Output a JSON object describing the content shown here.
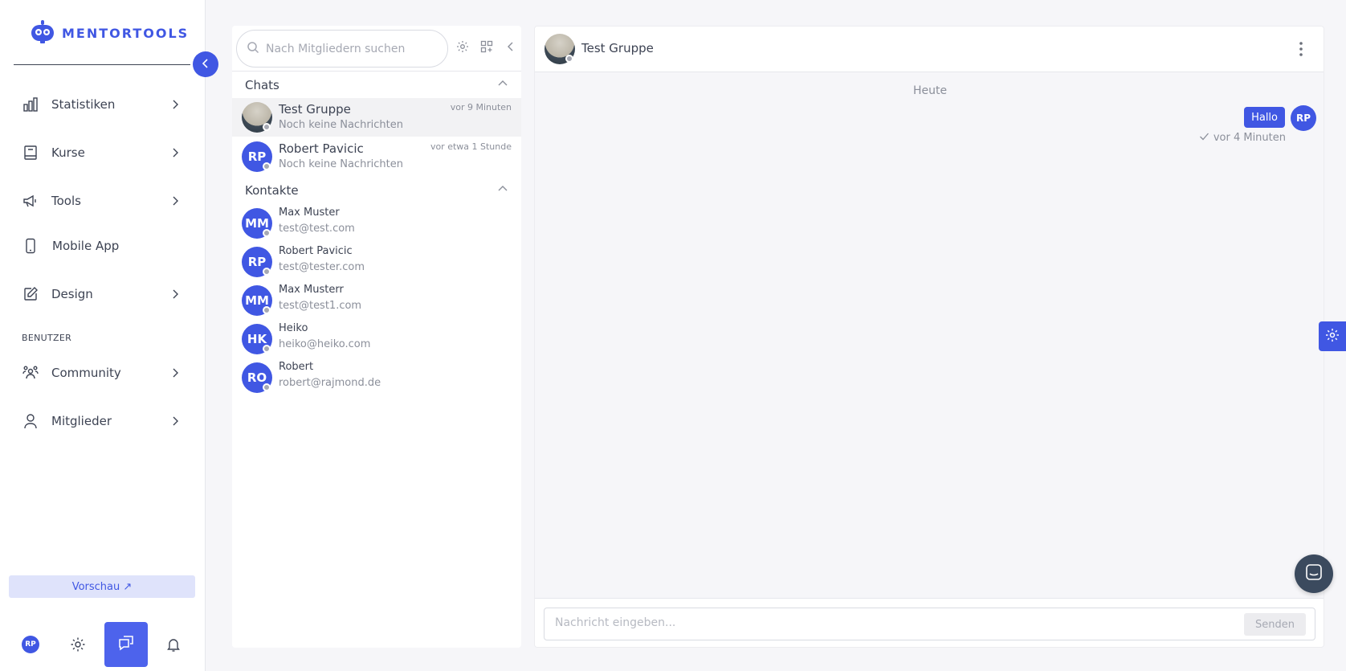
{
  "brand": {
    "name": "MENTORTOOLS",
    "accent": "#4057e3"
  },
  "sidebar": {
    "items": [
      {
        "label": "Statistiken",
        "icon": "bar-chart-icon",
        "has_chevron": true
      },
      {
        "label": "Kurse",
        "icon": "book-icon",
        "has_chevron": true
      },
      {
        "label": "Tools",
        "icon": "megaphone-icon",
        "has_chevron": true
      },
      {
        "label": "Mobile App",
        "icon": "smartphone-icon",
        "has_chevron": false
      },
      {
        "label": "Design",
        "icon": "pencil-icon",
        "has_chevron": true
      },
      {
        "label": "Community",
        "icon": "users-icon",
        "has_chevron": true
      },
      {
        "label": "Mitglieder",
        "icon": "user-icon",
        "has_chevron": true
      }
    ],
    "section_label": "BENUTZER",
    "preview_label": "Vorschau ↗",
    "user_initials": "RP"
  },
  "chat_list": {
    "search_placeholder": "Nach Mitgliedern suchen",
    "chats_heading": "Chats",
    "contacts_heading": "Kontakte",
    "chats": [
      {
        "name": "Test Gruppe",
        "preview": "Noch keine Nachrichten",
        "time": "vor 9 Minuten",
        "initials": "",
        "active": true
      },
      {
        "name": "Robert Pavicic",
        "preview": "Noch keine Nachrichten",
        "time": "vor etwa 1 Stunde",
        "initials": "RP",
        "active": false
      }
    ],
    "contacts": [
      {
        "initials": "MM",
        "name": "Max Muster",
        "email": "test@test.com"
      },
      {
        "initials": "RP",
        "name": "Robert Pavicic",
        "email": "test@tester.com"
      },
      {
        "initials": "MM",
        "name": "Max Musterr",
        "email": "test@test1.com"
      },
      {
        "initials": "HK",
        "name": "Heiko",
        "email": "heiko@heiko.com"
      },
      {
        "initials": "RO",
        "name": "Robert",
        "email": "robert@rajmond.de"
      }
    ]
  },
  "conversation": {
    "title": "Test Gruppe",
    "day_label": "Heute",
    "messages": [
      {
        "text": "Hallo",
        "initials": "RP",
        "time": "vor 4 Minuten"
      }
    ],
    "input_placeholder": "Nachricht eingeben...",
    "send_label": "Senden"
  }
}
